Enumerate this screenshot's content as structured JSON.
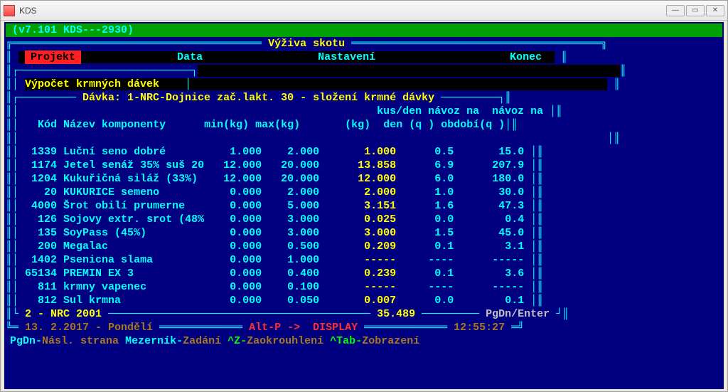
{
  "win_title": "KDS",
  "topbar": "(v7.101 KDS---2930)",
  "section_title": "Výživa skotu",
  "menu": {
    "projekt": "Projekt",
    "data": "Data",
    "nastaveni": "Nastavení",
    "konec": "Konec"
  },
  "subtitle": "Výpočet krmných dávek",
  "davka_title": "Dávka: 1-NRC-Dojnice zač.lakt. 30 - složení krmné dávky",
  "headers": {
    "kod": "Kód",
    "nazev": "Název komponenty",
    "min": "min(kg)",
    "max": "max(kg)",
    "kusden_top": "kus/den",
    "kusden_bot": "(kg)",
    "navozden_top": "návoz na",
    "navozden_bot": "den (q )",
    "navozobd_top": "návoz na",
    "navozobd_bot": "období(q )"
  },
  "rows": [
    {
      "kod": "1339",
      "nm": "Luční seno dobré",
      "min": "1.000",
      "max": "2.000",
      "kd": "1.000",
      "nd": "0.5",
      "no": "15.0"
    },
    {
      "kod": "1174",
      "nm": "Jetel senáž 35% suš 20",
      "min": "12.000",
      "max": "20.000",
      "kd": "13.858",
      "nd": "6.9",
      "no": "207.9"
    },
    {
      "kod": "1204",
      "nm": "Kukuřičná siláž (33%)",
      "min": "12.000",
      "max": "20.000",
      "kd": "12.000",
      "nd": "6.0",
      "no": "180.0"
    },
    {
      "kod": "20",
      "nm": "KUKURICE semeno",
      "min": "0.000",
      "max": "2.000",
      "kd": "2.000",
      "nd": "1.0",
      "no": "30.0"
    },
    {
      "kod": "4000",
      "nm": "Šrot obilí prumerne",
      "min": "0.000",
      "max": "5.000",
      "kd": "3.151",
      "nd": "1.6",
      "no": "47.3"
    },
    {
      "kod": "126",
      "nm": "Sojovy extr. srot (48%",
      "min": "0.000",
      "max": "3.000",
      "kd": "0.025",
      "nd": "0.0",
      "no": "0.4"
    },
    {
      "kod": "135",
      "nm": "SoyPass (45%)",
      "min": "0.000",
      "max": "3.000",
      "kd": "3.000",
      "nd": "1.5",
      "no": "45.0"
    },
    {
      "kod": "200",
      "nm": "Megalac",
      "min": "0.000",
      "max": "0.500",
      "kd": "0.209",
      "nd": "0.1",
      "no": "3.1"
    },
    {
      "kod": "1402",
      "nm": "Psenicna slama",
      "min": "0.000",
      "max": "1.000",
      "kd": "-----",
      "nd": "----",
      "no": "-----"
    },
    {
      "kod": "65134",
      "nm": "PREMIN EX 3",
      "min": "0.000",
      "max": "0.400",
      "kd": "0.239",
      "nd": "0.1",
      "no": "3.6"
    },
    {
      "kod": "811",
      "nm": "krmny vapenec",
      "min": "0.000",
      "max": "0.100",
      "kd": "-----",
      "nd": "----",
      "no": "-----"
    },
    {
      "kod": "812",
      "nm": "Sul krmna",
      "min": "0.000",
      "max": "0.050",
      "kd": "0.007",
      "nd": "0.0",
      "no": "0.1"
    }
  ],
  "sum": {
    "left": "2 - NRC 2001",
    "mid": "35.489",
    "right": "PgDn/Enter"
  },
  "dateline": {
    "date": "13. 2.2017 - Pondělí",
    "altp": "Alt-P ->  DISPLAY",
    "time": "12:55:27"
  },
  "help": {
    "seg1a": "PgDn-",
    "seg1b": "Násl. strana",
    "seg2a": "Mezerník-",
    "seg2b": "Zadání",
    "seg3a": "^Z-",
    "seg3b": "Zaokrouhlení",
    "seg4a": "^Tab-",
    "seg4b": "Zobrazení"
  }
}
